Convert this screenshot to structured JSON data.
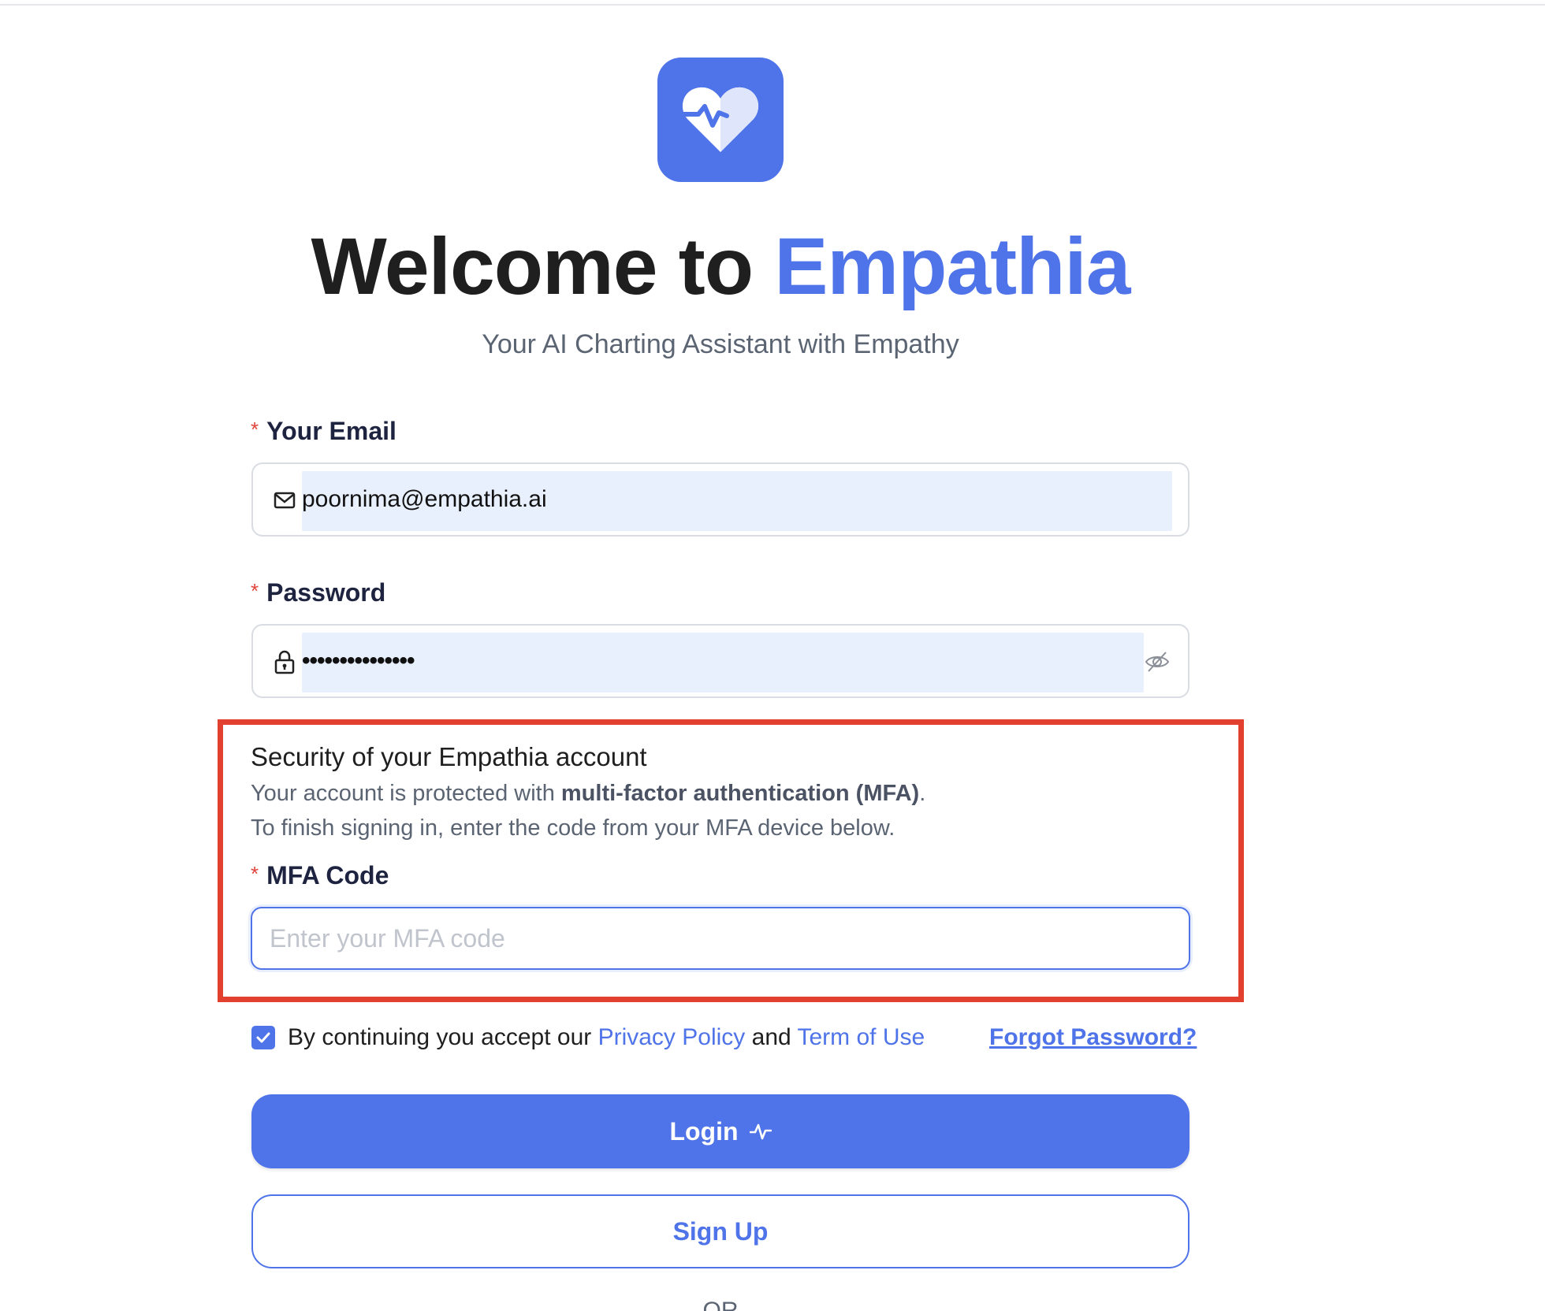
{
  "header": {
    "title_prefix": "Welcome to ",
    "title_brand": "Empathia",
    "subtitle": "Your AI Charting Assistant with Empathy"
  },
  "form": {
    "email_label": "Your Email",
    "email_value": "poornima@empathia.ai",
    "password_label": "Password",
    "password_value": "•••••••••••••••",
    "required_marker": "*"
  },
  "mfa": {
    "title": "Security of your Empathia account",
    "line1_prefix": "Your account is protected with ",
    "line1_bold": "multi-factor authentication (MFA)",
    "line1_suffix": ".",
    "line2": "To finish signing in, enter the code from your MFA device below.",
    "code_label": "MFA Code",
    "code_placeholder": "Enter your MFA code"
  },
  "consent": {
    "checked": true,
    "text_prefix": "By continuing you accept our ",
    "privacy_link": "Privacy Policy",
    "and_text": " and ",
    "terms_link": "Term of Use",
    "forgot_link": "Forgot Password?"
  },
  "buttons": {
    "login_label": "Login",
    "signup_label": "Sign Up",
    "or_text": "OR"
  },
  "colors": {
    "brand": "#4f73e8",
    "highlight_box": "#e3412f",
    "required": "#e0443a",
    "autofill": "#e8effd"
  },
  "icons": {
    "logo": "heart-pulse-icon",
    "email": "mail-icon",
    "password": "lock-icon",
    "visibility": "eye-off-icon",
    "checkbox": "check-icon",
    "login": "pulse-icon"
  }
}
